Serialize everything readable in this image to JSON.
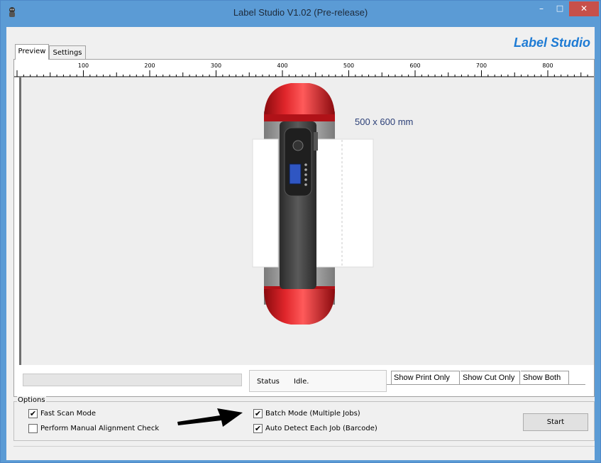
{
  "window": {
    "title": "Label Studio V1.02 (Pre-release)",
    "controls": {
      "minimize": "–",
      "maximize": "□",
      "close": "✕"
    }
  },
  "brand": {
    "text": "Label Studio",
    "color": "#1e7bd4"
  },
  "tabs": [
    {
      "label": "Preview",
      "active": true
    },
    {
      "label": "Settings",
      "active": false
    }
  ],
  "ruler": {
    "labels": [
      "100",
      "200",
      "300",
      "400",
      "500",
      "600",
      "700",
      "800"
    ]
  },
  "preview": {
    "size_label": "500 x 600 mm",
    "device_color": "#d4141a"
  },
  "status": {
    "label": "Status",
    "value": "Idle."
  },
  "view_tabs": [
    "Show Print Only",
    "Show Cut Only",
    "Show Both"
  ],
  "options": {
    "legend": "Options",
    "fast_scan": {
      "label": "Fast Scan Mode",
      "checked": true
    },
    "manual_alignment": {
      "label": "Perform Manual Alignment Check",
      "checked": false
    },
    "batch_mode": {
      "label": "Batch Mode (Multiple Jobs)",
      "checked": true
    },
    "auto_detect": {
      "label": "Auto Detect Each Job (Barcode)",
      "checked": true
    },
    "start_button": "Start"
  },
  "colors": {
    "title_bar": "#5b9bd5",
    "close_button": "#c7504a"
  }
}
